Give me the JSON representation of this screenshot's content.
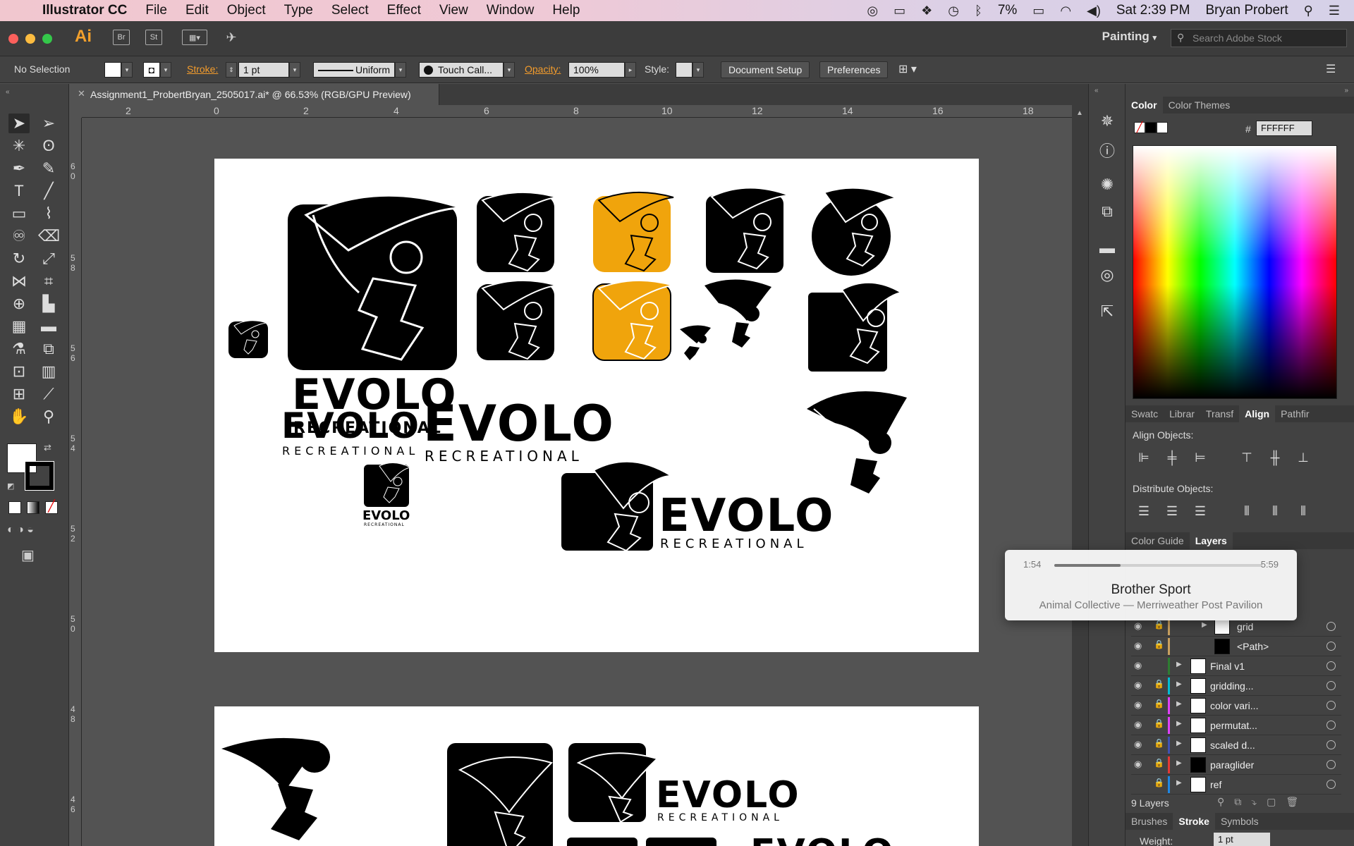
{
  "menubar": {
    "app_name": "Illustrator CC",
    "menus": [
      "File",
      "Edit",
      "Object",
      "Type",
      "Select",
      "Effect",
      "View",
      "Window",
      "Help"
    ],
    "battery": "7%",
    "clock": "Sat 2:39 PM",
    "user": "Bryan Probert"
  },
  "appbar": {
    "logo": "Ai",
    "bridge": "Br",
    "stock": "St",
    "workspace": "Painting",
    "search_placeholder": "Search Adobe Stock"
  },
  "controlbar": {
    "selection": "No Selection",
    "stroke_label": "Stroke:",
    "stroke_weight": "1 pt",
    "stroke_profile": "Uniform",
    "brush": "Touch Call...",
    "opacity_label": "Opacity:",
    "opacity": "100%",
    "style_label": "Style:",
    "document_setup": "Document Setup",
    "preferences": "Preferences"
  },
  "document": {
    "tab_title": "Assignment1_ProbertBryan_2505017.ai* @ 66.53% (RGB/GPU Preview)",
    "ruler_h": [
      "2",
      "0",
      "2",
      "4",
      "6",
      "8",
      "10",
      "12",
      "14",
      "16",
      "18"
    ],
    "ruler_v": [
      "6 0",
      "5 8",
      "5 6",
      "5 4",
      "5 2",
      "5 0",
      "4 8",
      "4 6"
    ]
  },
  "artwork": {
    "wordmark": "EVOLO",
    "tagline": "RECREATIONAL",
    "accent_color": "#f0a40c"
  },
  "panels": {
    "color_tabs": [
      "Color",
      "Color Themes"
    ],
    "hex_label": "#",
    "hex_value": "FFFFFF",
    "mid_tabs": [
      "Swatc",
      "Librar",
      "Transf",
      "Align",
      "Pathfir"
    ],
    "align_objects": "Align Objects:",
    "distribute_objects": "Distribute Objects:",
    "lower_tabs": [
      "Color Guide",
      "Layers"
    ],
    "layers": [
      {
        "name": "grid",
        "color": "#c8a060",
        "sub": true
      },
      {
        "name": "<Path>",
        "color": "#c8a060",
        "sub": true
      },
      {
        "name": "Final v1",
        "color": "#2e7d32",
        "sub": false
      },
      {
        "name": "gridding...",
        "color": "#00bcd4",
        "sub": false
      },
      {
        "name": "color vari...",
        "color": "#e040fb",
        "sub": false
      },
      {
        "name": "permutat...",
        "color": "#e040fb",
        "sub": false
      },
      {
        "name": "scaled d...",
        "color": "#3f51b5",
        "sub": false
      },
      {
        "name": "paraglider",
        "color": "#e53935",
        "sub": false
      },
      {
        "name": "ref",
        "color": "#1e88e5",
        "sub": false
      }
    ],
    "layer_count": "9 Layers",
    "bottom_tabs": [
      "Brushes",
      "Stroke",
      "Symbols"
    ],
    "weight_label": "Weight:",
    "weight_value": "1 pt"
  },
  "now_playing": {
    "elapsed": "1:54",
    "total": "5:59",
    "progress": 0.32,
    "title": "Brother Sport",
    "subtitle": "Animal Collective — Merriweather Post Pavilion"
  }
}
